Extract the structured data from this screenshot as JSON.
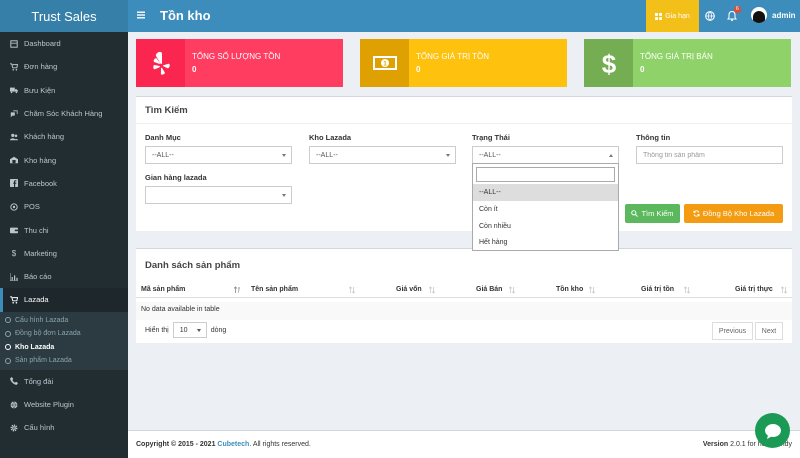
{
  "app": {
    "name": "Trust Sales"
  },
  "header": {
    "title": "Tồn kho",
    "renew_label": "Gia hạn",
    "notification_count": "6",
    "username": "admin"
  },
  "sidebar": {
    "items": [
      {
        "label": "Dashboard",
        "icon": "dashboard-icon"
      },
      {
        "label": "Đơn hàng",
        "icon": "cart-icon"
      },
      {
        "label": "Bưu Kiện",
        "icon": "truck-icon"
      },
      {
        "label": "Chăm Sóc Khách Hàng",
        "icon": "support-icon"
      },
      {
        "label": "Khách hàng",
        "icon": "users-icon"
      },
      {
        "label": "Kho hàng",
        "icon": "warehouse-icon"
      },
      {
        "label": "Facebook",
        "icon": "facebook-icon"
      },
      {
        "label": "POS",
        "icon": "pos-icon"
      },
      {
        "label": "Thu chi",
        "icon": "wallet-icon"
      },
      {
        "label": "Marketing",
        "icon": "dollar-icon"
      },
      {
        "label": "Báo cáo",
        "icon": "chart-icon"
      },
      {
        "label": "Lazada",
        "icon": "cart-icon"
      }
    ],
    "lazada_sub": [
      {
        "label": "Cấu hình Lazada"
      },
      {
        "label": "Đồng bộ đơn Lazada"
      },
      {
        "label": "Kho Lazada"
      },
      {
        "label": "Sản phẩm Lazada"
      }
    ],
    "bottom_items": [
      {
        "label": "Tổng đài",
        "icon": "phone-icon"
      },
      {
        "label": "Website Plugin",
        "icon": "globe-icon"
      },
      {
        "label": "Cấu hình",
        "icon": "gear-icon"
      }
    ]
  },
  "stats": [
    {
      "title": "Tổng số lượng tồn",
      "value": "0",
      "icon": "yelp-icon",
      "color": "#ff3d61"
    },
    {
      "title": "Tổng giá trị tồn",
      "value": "0",
      "icon": "money-icon",
      "color": "#fec10d"
    },
    {
      "title": "Tổng giá trị bán",
      "value": "0",
      "icon": "dollar-icon",
      "color": "#90d26a"
    }
  ],
  "search": {
    "title": "Tìm Kiếm",
    "category_label": "Danh Mục",
    "category_value": "--ALL--",
    "kho_label": "Kho Lazada",
    "kho_value": "--ALL--",
    "status_label": "Trạng Thái",
    "status_value": "--ALL--",
    "info_label": "Thông tin",
    "info_placeholder": "Thông tin sản phẩm",
    "shop_label": "Gian hàng lazada",
    "shop_value": "",
    "search_button": "Tìm Kiếm",
    "sync_button": "Đồng Bộ Kho Lazada",
    "status_options": [
      "--ALL--",
      "Còn ít",
      "Còn nhiều",
      "Hết hàng"
    ]
  },
  "table": {
    "title": "Danh sách sản phẩm",
    "columns": [
      "Mã sản phẩm",
      "Tên sản phẩm",
      "Giá vốn",
      "Giá Bán",
      "Tồn kho",
      "Giá trị tồn",
      "Giá trị thực"
    ],
    "empty_text": "No data available in table",
    "show_label": "Hiển thị",
    "page_size": "10",
    "entries_label": "dòng",
    "prev_label": "Previous",
    "next_label": "Next"
  },
  "footer": {
    "copyright_prefix": "Copyright © 2015 - 2021",
    "company": "Cubetech",
    "rights": ". All rights reserved.",
    "version_label": "Version",
    "version_text": "2.0.1 for houseandy"
  },
  "colors": {
    "header": "#3c8dbc",
    "sidebar": "#222d32",
    "renew": "#f3c019",
    "search_btn": "#5cb85c",
    "sync_btn": "#f39c12",
    "chat": "#1a9a55"
  }
}
